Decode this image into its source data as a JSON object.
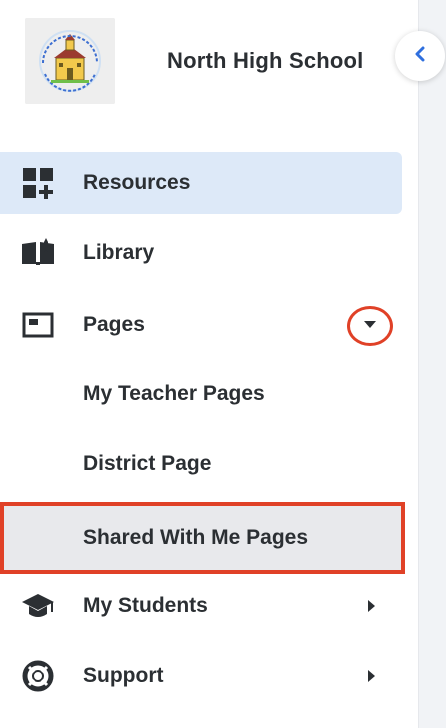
{
  "header": {
    "school_name": "North High School",
    "logo_icon": "school-building-logo",
    "collapse_icon": "chevron-left-icon"
  },
  "nav": {
    "resources": {
      "label": "Resources",
      "icon": "grid-plus-icon",
      "active": true
    },
    "library": {
      "label": "Library",
      "icon": "open-book-icon"
    },
    "pages": {
      "label": "Pages",
      "icon": "page-window-icon",
      "expanded": true
    },
    "sub_items": [
      {
        "label": "My Teacher Pages"
      },
      {
        "label": "District Page"
      },
      {
        "label": "Shared With Me Pages"
      }
    ],
    "my_students": {
      "label": "My Students",
      "icon": "graduation-cap-icon"
    },
    "support": {
      "label": "Support",
      "icon": "lifebuoy-icon"
    }
  },
  "colors": {
    "active_bg": "#dde9f8",
    "highlight_red": "#e04127",
    "accent_blue": "#2f6fde",
    "text": "#2b2f33"
  }
}
